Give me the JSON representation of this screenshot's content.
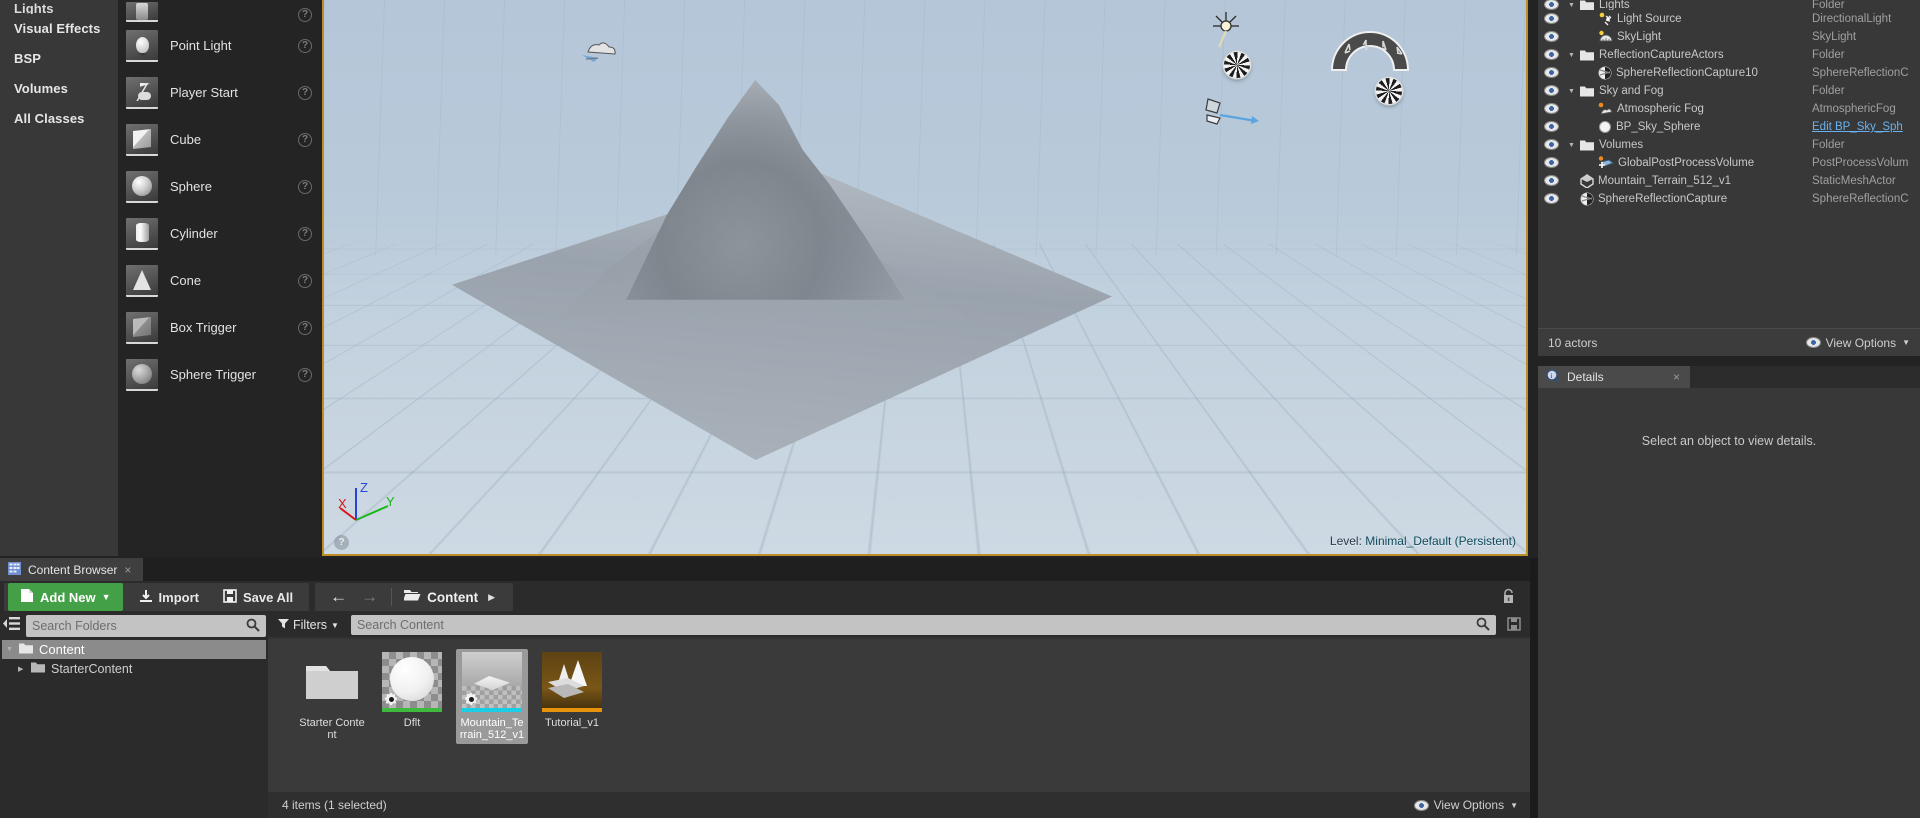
{
  "place_actors": {
    "categories": [
      {
        "label": "Lights",
        "partial": true
      },
      {
        "label": "Visual Effects",
        "partial": false
      },
      {
        "label": "BSP",
        "partial": false
      },
      {
        "label": "Volumes",
        "partial": false
      },
      {
        "label": "All Classes",
        "partial": false
      }
    ],
    "items": [
      {
        "label": "",
        "icon": "empty-actor-icon",
        "glyph": "g-empty",
        "clipped": true
      },
      {
        "label": "Point Light",
        "icon": "point-light-icon",
        "glyph": "g-bulb"
      },
      {
        "label": "Player Start",
        "icon": "player-start-icon",
        "glyph": "g-player"
      },
      {
        "label": "Cube",
        "icon": "cube-icon",
        "glyph": "g-cube"
      },
      {
        "label": "Sphere",
        "icon": "sphere-icon",
        "glyph": "g-sphere"
      },
      {
        "label": "Cylinder",
        "icon": "cylinder-icon",
        "glyph": "g-cyl"
      },
      {
        "label": "Cone",
        "icon": "cone-icon",
        "glyph": "g-cone"
      },
      {
        "label": "Box Trigger",
        "icon": "box-trigger-icon",
        "glyph": "g-boxtrig"
      },
      {
        "label": "Sphere Trigger",
        "icon": "sphere-trigger-icon",
        "glyph": "g-sphtrig"
      }
    ],
    "help_glyph": "?"
  },
  "viewport": {
    "level_prefix": "Level:",
    "level_name": "Minimal_Default (Persistent)",
    "axis_labels": {
      "x": "X",
      "y": "Y",
      "z": "Z"
    },
    "help_glyph": "?",
    "border_color": "#c08c2a",
    "sky_color": "#b9cada"
  },
  "outliner": {
    "rows": [
      {
        "indent": 1,
        "expander": "down",
        "icon": "folder-icon",
        "label": "Lights",
        "type": "Folder",
        "clipped": true
      },
      {
        "indent": 2,
        "expander": "none",
        "icon": "directional-light-icon",
        "label": "Light Source",
        "type": "DirectionalLight"
      },
      {
        "indent": 2,
        "expander": "none",
        "icon": "sky-light-icon",
        "label": "SkyLight",
        "type": "SkyLight"
      },
      {
        "indent": 1,
        "expander": "down",
        "icon": "folder-icon",
        "label": "ReflectionCaptureActors",
        "type": "Folder"
      },
      {
        "indent": 2,
        "expander": "none",
        "icon": "sphere-reflection-capture-icon",
        "label": "SphereReflectionCapture10",
        "type": "SphereReflectionC"
      },
      {
        "indent": 1,
        "expander": "down",
        "icon": "folder-icon",
        "label": "Sky and Fog",
        "type": "Folder"
      },
      {
        "indent": 2,
        "expander": "none",
        "icon": "atmospheric-fog-icon",
        "label": "Atmospheric Fog",
        "type": "AtmosphericFog"
      },
      {
        "indent": 2,
        "expander": "none",
        "icon": "blueprint-sphere-icon",
        "label": "BP_Sky_Sphere",
        "type": "Edit BP_Sky_Sph",
        "is_link": true
      },
      {
        "indent": 1,
        "expander": "down",
        "icon": "folder-icon",
        "label": "Volumes",
        "type": "Folder"
      },
      {
        "indent": 2,
        "expander": "none",
        "icon": "post-process-volume-icon",
        "label": "GlobalPostProcessVolume",
        "type": "PostProcessVolum"
      },
      {
        "indent": 1,
        "expander": "none",
        "icon": "static-mesh-actor-icon",
        "label": "Mountain_Terrain_512_v1",
        "type": "StaticMeshActor"
      },
      {
        "indent": 1,
        "expander": "none",
        "icon": "sphere-reflection-capture-icon",
        "label": "SphereReflectionCapture",
        "type": "SphereReflectionC"
      }
    ],
    "actor_count": "10 actors",
    "view_options": "View Options"
  },
  "details": {
    "tab_label": "Details",
    "close_glyph": "×",
    "empty_message": "Select an object to view details."
  },
  "content_browser": {
    "tab_label": "Content Browser",
    "close_glyph": "×",
    "toolbar": {
      "add_new": "Add New",
      "import": "Import",
      "save_all": "Save All",
      "breadcrumb_root": "Content"
    },
    "folder_search_placeholder": "Search Folders",
    "folder_tree": [
      {
        "label": "Content",
        "selected": true,
        "depth": 0,
        "expander": "down"
      },
      {
        "label": "StarterContent",
        "selected": false,
        "depth": 1,
        "expander": "right"
      }
    ],
    "filters_label": "Filters",
    "content_search_placeholder": "Search Content",
    "tiles": [
      {
        "label": "Starter Content",
        "kind": "folder",
        "accent": "none",
        "selected": false
      },
      {
        "label": "Dflt",
        "kind": "material",
        "accent": "#3fba3f",
        "selected": false
      },
      {
        "label": "Mountain_Terrain_512_v1",
        "kind": "staticmesh",
        "accent": "#18cfe6",
        "selected": true
      },
      {
        "label": "Tutorial_v1",
        "kind": "map",
        "accent": "#e8930c",
        "selected": false
      }
    ],
    "status_text": "4 items (1 selected)",
    "view_options": "View Options"
  }
}
